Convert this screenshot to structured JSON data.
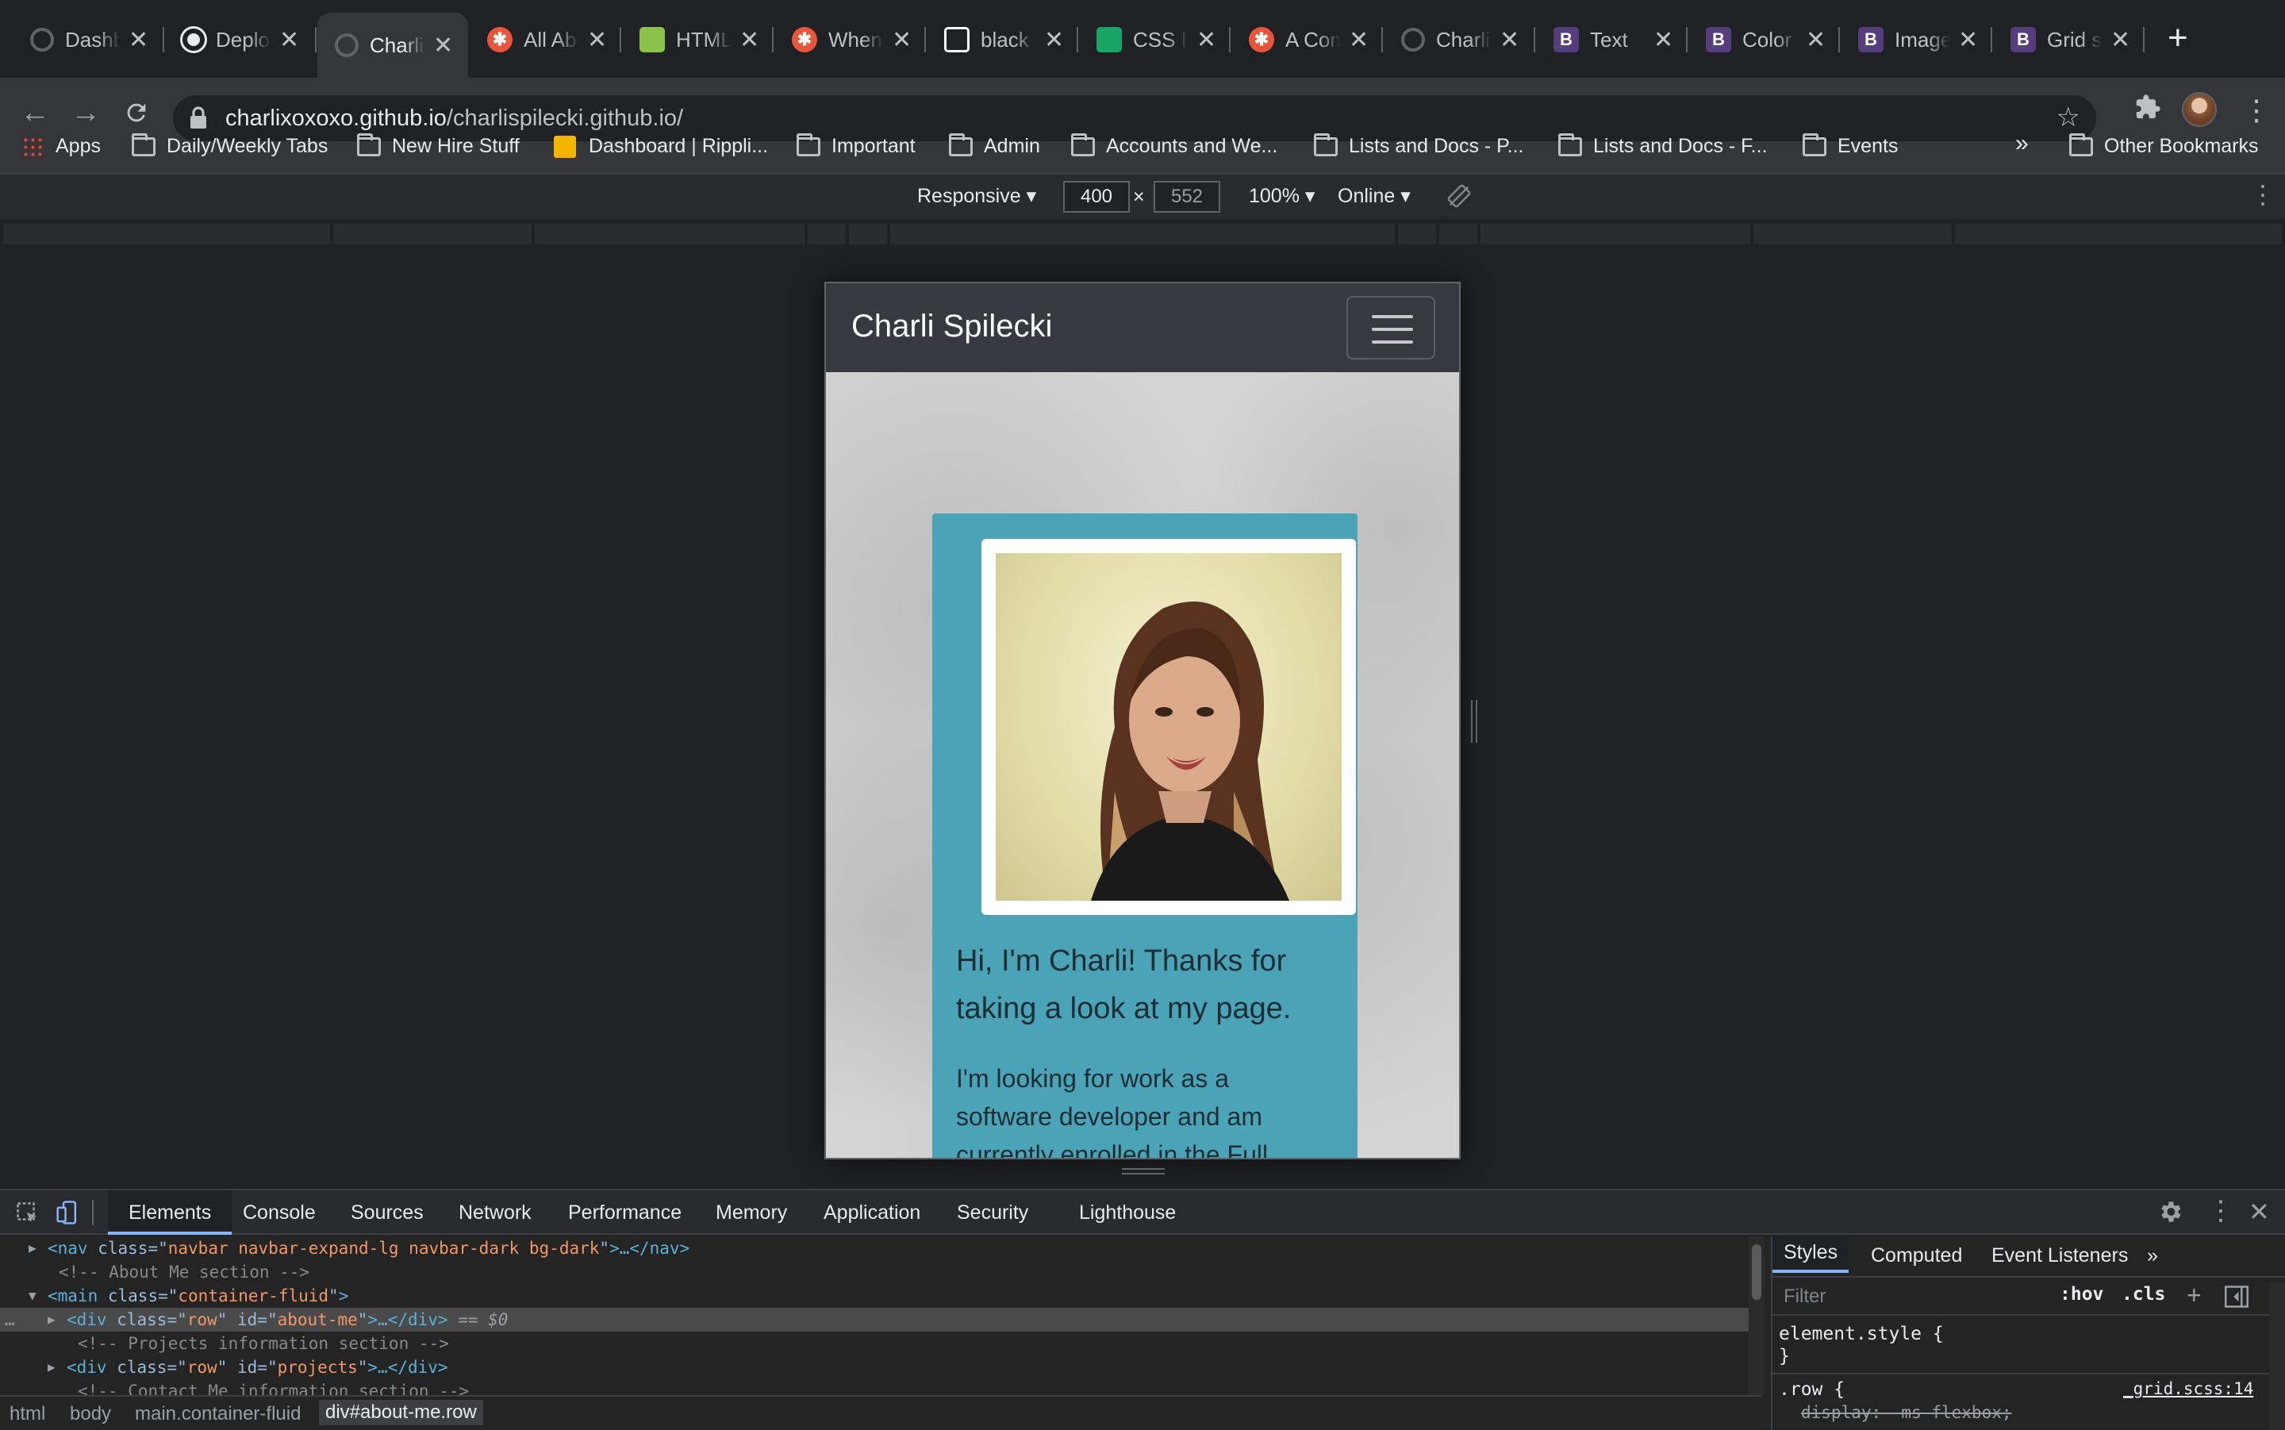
{
  "browser": {
    "tabs": [
      {
        "label": "Dashboard",
        "icon": "globe-icon",
        "color": "#5f6368"
      },
      {
        "label": "Deploying",
        "icon": "github-icon",
        "color": "#ffffff"
      },
      {
        "label": "Charli Spilecki",
        "icon": "globe-icon",
        "color": "#5f6368",
        "active": true
      },
      {
        "label": "All About",
        "icon": "asterisk-icon",
        "color": "#e8553b"
      },
      {
        "label": "HTML",
        "icon": "w3-icon",
        "color": "#8bc34a"
      },
      {
        "label": "When",
        "icon": "asterisk-icon",
        "color": "#e8553b"
      },
      {
        "label": "black",
        "icon": "unsplash-icon",
        "color": "#ffffff"
      },
      {
        "label": "CSS I",
        "icon": "ac-icon",
        "color": "#18a566"
      },
      {
        "label": "A Com",
        "icon": "asterisk-icon",
        "color": "#e8553b"
      },
      {
        "label": "Charli",
        "icon": "globe-icon",
        "color": "#5f6368"
      },
      {
        "label": "Text",
        "icon": "bootstrap-icon",
        "color": "#563d7c"
      },
      {
        "label": "Color",
        "icon": "bootstrap-icon",
        "color": "#563d7c"
      },
      {
        "label": "Image",
        "icon": "bootstrap-icon",
        "color": "#563d7c"
      },
      {
        "label": "Grid s",
        "icon": "bootstrap-icon",
        "color": "#563d7c"
      }
    ],
    "new_tab_glyph": "+",
    "close_glyph": "✕",
    "url_host": "charlixoxoxo.github.io",
    "url_path": "/charlispilecki.github.io/",
    "bookmarks": [
      {
        "label": "Apps",
        "icon": "apps-grid-icon"
      },
      {
        "label": "Daily/Weekly Tabs",
        "icon": "folder-icon"
      },
      {
        "label": "New Hire Stuff",
        "icon": "folder-icon"
      },
      {
        "label": "Dashboard | Rippli...",
        "icon": "rippling-icon"
      },
      {
        "label": "Important",
        "icon": "folder-icon"
      },
      {
        "label": "Admin",
        "icon": "folder-icon"
      },
      {
        "label": "Accounts and We...",
        "icon": "folder-icon"
      },
      {
        "label": "Lists and Docs - P...",
        "icon": "folder-icon"
      },
      {
        "label": "Lists and Docs - F...",
        "icon": "folder-icon"
      },
      {
        "label": "Events",
        "icon": "folder-icon"
      }
    ],
    "bookmarks_overflow": "»",
    "other_bookmarks": "Other Bookmarks"
  },
  "device_toolbar": {
    "device": "Responsive ▾",
    "width": "400",
    "times": "×",
    "height": "552",
    "zoom": "100% ▾",
    "throttle": "Online ▾"
  },
  "site": {
    "brand": "Charli Spilecki",
    "greeting": "Hi, I'm Charli! Thanks for taking a look at my page.",
    "intro": "I'm looking for work as a software developer and am currently enrolled in the Full"
  },
  "devtools": {
    "tabs": [
      "Elements",
      "Console",
      "Sources",
      "Network",
      "Performance",
      "Memory",
      "Application",
      "Security",
      "Lighthouse"
    ],
    "dom_lines": [
      {
        "arrow": "▶",
        "open": "<nav",
        "attrs": [
          [
            "class",
            "navbar navbar-expand-lg navbar-dark bg-dark"
          ]
        ],
        "close": ">…</nav>",
        "suffix": ""
      },
      {
        "comment": "<!-- About Me section -->"
      },
      {
        "arrow": "▼",
        "open": "<main",
        "attrs": [
          [
            "class",
            "container-fluid"
          ]
        ],
        "close": ">",
        "suffix": ""
      },
      {
        "arrow": "▶",
        "open": "<div",
        "attrs": [
          [
            "class",
            "row"
          ],
          [
            "id",
            "about-me"
          ]
        ],
        "close": ">…</div>",
        "suffix": " == $0",
        "selected": true
      },
      {
        "comment": "<!-- Projects information section -->"
      },
      {
        "arrow": "▶",
        "open": "<div",
        "attrs": [
          [
            "class",
            "row"
          ],
          [
            "id",
            "projects"
          ]
        ],
        "close": ">…</div>",
        "suffix": ""
      },
      {
        "comment": "<!-- Contact Me information section -->"
      }
    ],
    "breadcrumbs": [
      "html",
      "body",
      "main.container-fluid",
      "div#about-me.row"
    ],
    "styles_tabs": [
      "Styles",
      "Computed",
      "Event Listeners",
      "»"
    ],
    "filter_placeholder": "Filter",
    "hov": ":hov",
    "cls": ".cls",
    "rule1_selector": "element.style {",
    "rule1_close": "}",
    "rule2_selector": ".row {",
    "rule2_source": "_grid.scss:14",
    "rule2_prop": "display: -ms-flexbox;"
  }
}
